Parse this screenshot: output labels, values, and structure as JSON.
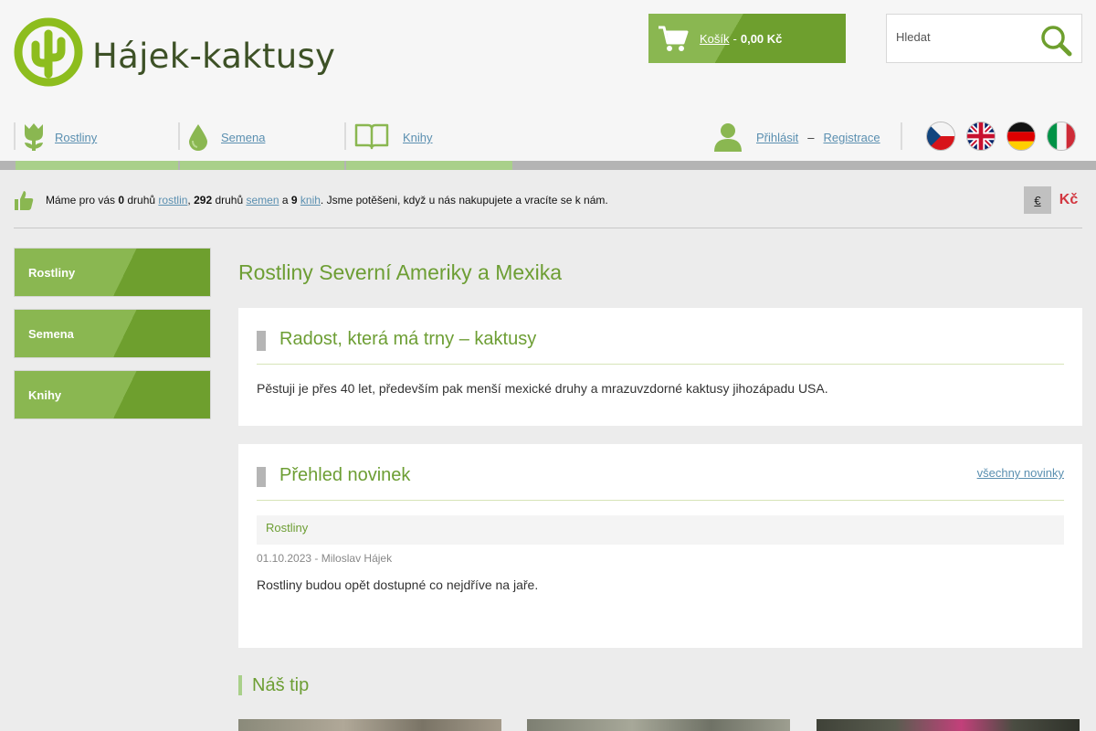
{
  "header": {
    "logo_text": "Hájek-kaktusy",
    "cart": {
      "label": "Košík",
      "separator": "-",
      "total": "0,00 Kč"
    },
    "search": {
      "placeholder": "Hledat"
    }
  },
  "nav": {
    "items": [
      {
        "label": "Rostliny",
        "icon": "tulip-icon"
      },
      {
        "label": "Semena",
        "icon": "seed-drop-icon"
      },
      {
        "label": "Knihy",
        "icon": "book-icon"
      }
    ]
  },
  "user": {
    "login": "Přihlásit",
    "dash": "–",
    "register": "Registrace"
  },
  "languages": [
    "cz-flag-icon",
    "gb-flag-icon",
    "de-flag-icon",
    "it-flag-icon"
  ],
  "info": {
    "p1": "Máme pro vás ",
    "plants_count": "0",
    "p2": " druhů ",
    "plants_link": "rostlin",
    "p3": ", ",
    "seeds_count": "292",
    "p4": " druhů ",
    "seeds_link": "semen",
    "p5": " a ",
    "books_count": "9",
    "p6": " ",
    "books_link": "knih",
    "p7": ". Jsme potěšeni, když u nás nakupujete a vracíte se k nám."
  },
  "currency": {
    "eur": "€",
    "czk": "Kč"
  },
  "sidebar": {
    "items": [
      "Rostliny",
      "Semena",
      "Knihy"
    ]
  },
  "main": {
    "title": "Rostliny Severní Ameriky a Mexika",
    "intro": {
      "heading": "Radost, která má trny – kaktusy",
      "text": "Pěstuji je přes 40 let, především pak menší mexické druhy a mrazuvzdorné kaktusy jihozápadu USA."
    },
    "news": {
      "heading": "Přehled novinek",
      "all_link": "všechny novinky",
      "category": "Rostliny",
      "meta": "01.10.2023 - Miloslav Hájek",
      "text": "Rostliny budou opět dostupné co nejdříve na jaře."
    },
    "tip": {
      "heading": "Náš tip"
    }
  },
  "colors": {
    "accent": "#6d9e34",
    "accent_light": "#8ab751",
    "link": "#5a8fb0",
    "price_red": "#d2363f"
  }
}
